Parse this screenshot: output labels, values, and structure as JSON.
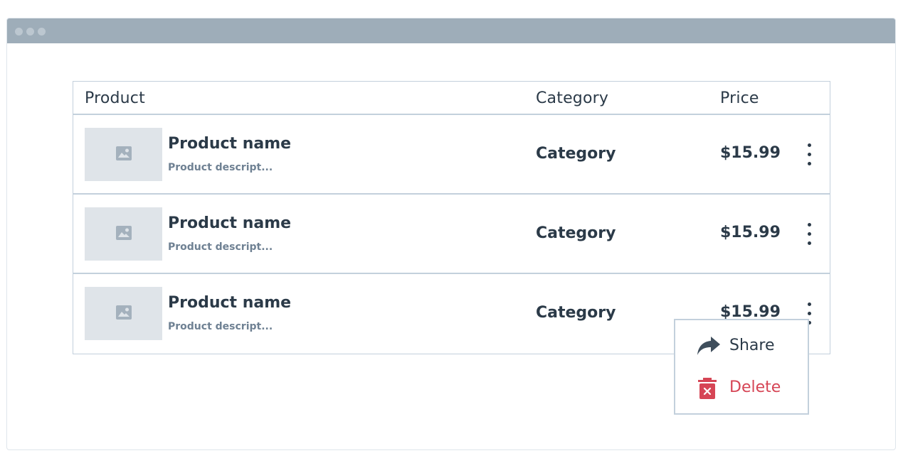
{
  "colors": {
    "titlebar": "#9eadb9",
    "border": "#c3d0dc",
    "text": "#2b3a48",
    "muted": "#6f8193",
    "thumb_bg": "#dfe4e9",
    "danger": "#d64555"
  },
  "table": {
    "headers": {
      "product": "Product",
      "category": "Category",
      "price": "Price"
    },
    "rows": [
      {
        "name": "Product name",
        "description": "Product descript...",
        "category": "Category",
        "price": "$15.99",
        "thumbnail_icon": "image-icon",
        "actions_icon": "more-vertical-icon"
      },
      {
        "name": "Product name",
        "description": "Product descript...",
        "category": "Category",
        "price": "$15.99",
        "thumbnail_icon": "image-icon",
        "actions_icon": "more-vertical-icon"
      },
      {
        "name": "Product name",
        "description": "Product descript...",
        "category": "Category",
        "price": "$15.99",
        "thumbnail_icon": "image-icon",
        "actions_icon": "more-vertical-icon"
      }
    ]
  },
  "context_menu": {
    "items": [
      {
        "label": "Share",
        "icon": "share-icon"
      },
      {
        "label": "Delete",
        "icon": "trash-icon"
      }
    ]
  }
}
